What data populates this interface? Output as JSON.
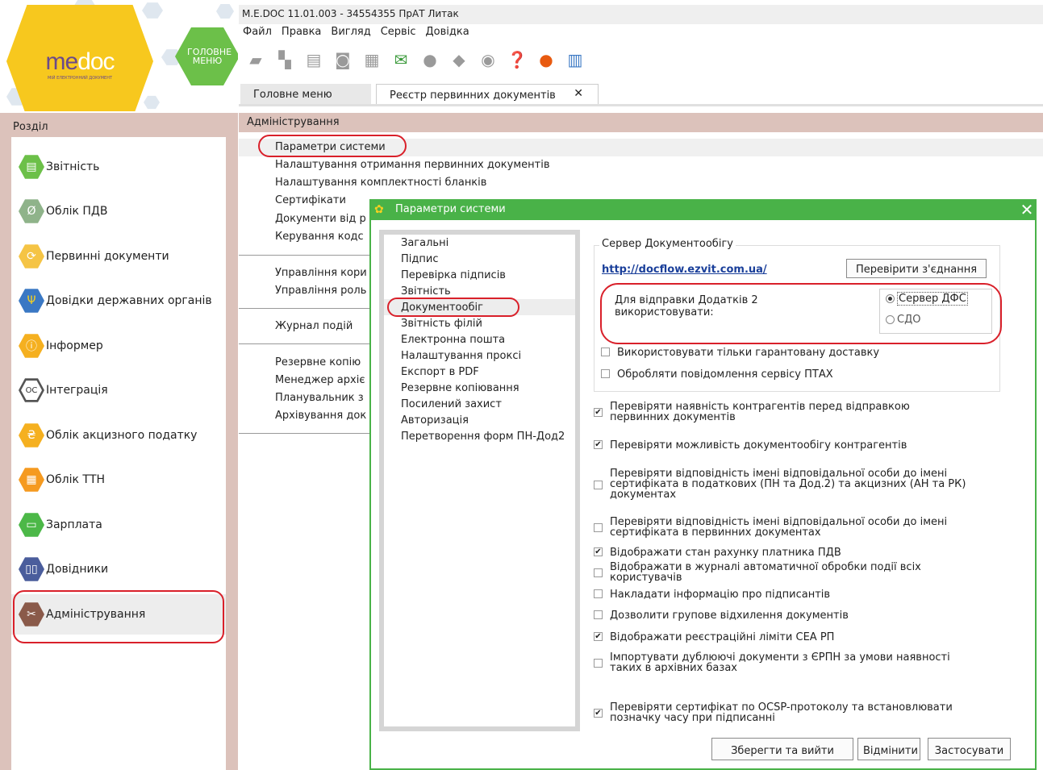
{
  "window": {
    "title": "M.E.DOC 11.01.003 - 34554355 ПрАТ Литак"
  },
  "brand": {
    "name_me": "me",
    "name_doc": "doc",
    "tagline": "МІЙ ЕЛЕКТРОННИЙ ДОКУМЕНТ",
    "main_menu_label": "ГОЛОВНЕ МЕНЮ"
  },
  "menu": [
    "Файл",
    "Правка",
    "Вигляд",
    "Сервіс",
    "Довідка"
  ],
  "tabs": {
    "main": "Головне меню",
    "registry": "Реєстр первинних документів",
    "close": "✕"
  },
  "sidebar": {
    "header": "Розділ",
    "items": [
      {
        "label": "Звітність",
        "icon": "report-icon",
        "color": "#6cc049"
      },
      {
        "label": "Облік ПДВ",
        "icon": "vat-icon",
        "color": "#8fb38a"
      },
      {
        "label": "Первинні документи",
        "icon": "primary-docs-icon",
        "color": "#f5c445"
      },
      {
        "label": "Довідки державних органів",
        "icon": "trident-icon",
        "color": "#3a78c4"
      },
      {
        "label": "Інформер",
        "icon": "info-icon",
        "color": "#f5b020"
      },
      {
        "label": "Інтеграція",
        "icon": "integration-icon",
        "color": "#ffffff"
      },
      {
        "label": "Облік акцизного податку",
        "icon": "excise-icon",
        "color": "#f5b020"
      },
      {
        "label": "Облік ТТН",
        "icon": "ttn-icon",
        "color": "#f59a20"
      },
      {
        "label": "Зарплата",
        "icon": "salary-icon",
        "color": "#4cb848"
      },
      {
        "label": "Довідники",
        "icon": "book-icon",
        "color": "#4a5d9c"
      },
      {
        "label": "Адміністрування",
        "icon": "admin-icon",
        "color": "#8a5a4a"
      }
    ]
  },
  "content": {
    "header": "Адміністрування",
    "links": [
      "Параметри системи",
      "Налаштування отримання первинних документів",
      "Налаштування комплектності бланків",
      "Сертифікати",
      "Документи від р",
      "Керування кодс",
      "Управління кори",
      "Управління роль",
      "Журнал подій",
      "Резервне копію",
      "Менеджер архіє",
      "Планувальник з",
      "Архівування док"
    ]
  },
  "dialog": {
    "title": "Параметри системи",
    "close": "✕",
    "nav": [
      "Загальні",
      "Підпис",
      "Перевірка підписів",
      "Звітність",
      "Документообіг",
      "Звітність філій",
      "Електронна пошта",
      "Налаштування проксі",
      "Експорт в PDF",
      "Резервне копіювання",
      "Посилений захист",
      "Авторизація",
      "Перетворення форм ПН-Дод2"
    ],
    "server_group_title": "Сервер Документообігу",
    "server_url": "http://docflow.ezvit.com.ua/",
    "check_button": "Перевірити з'єднання",
    "send_label": "Для відправки Додатків 2\nвикористовувати:",
    "radio_options": [
      {
        "label": "Сервер ДФС",
        "checked": true
      },
      {
        "label": "СДО",
        "checked": false
      }
    ],
    "group_checks": [
      {
        "label": "Використовувати тільки гарантовану доставку",
        "checked": false
      },
      {
        "label": "Обробляти повідомлення сервісу ПТАХ",
        "checked": false
      }
    ],
    "checks": [
      {
        "label": "Перевіряти наявність контрагентів перед відправкою\nпервинних документів",
        "checked": true
      },
      {
        "label": "Перевіряти можливість документообігу контрагентів",
        "checked": true
      },
      {
        "label": "Перевіряти відповідність імені відповідальної особи до імені\nсертифіката в податкових (ПН та Дод.2) та акцизних (АН та РК)\nдокументах",
        "checked": false
      },
      {
        "label": "Перевіряти відповідність імені відповідальної особи до імені\nсертифіката в первинних документах",
        "checked": false
      },
      {
        "label": "Відображати стан рахунку платника ПДВ",
        "checked": true
      },
      {
        "label": "Відображати в журналі автоматичної обробки події всіх\nкористувачів",
        "checked": false
      },
      {
        "label": "Накладати інформацію про підписантів",
        "checked": false
      },
      {
        "label": "Дозволити групове відхилення документів",
        "checked": false
      },
      {
        "label": "Відображати реєстраційні ліміти СЕА РП",
        "checked": true
      },
      {
        "label": "Імпортувати дублюючі документи з ЄРПН за умови наявності\nтаких в архівних базах",
        "checked": false
      },
      {
        "label": "Перевіряти сертифікат по OCSP-протоколу та встановлювати\nпозначку часу при підписанні",
        "checked": true
      }
    ],
    "buttons": {
      "save": "Зберегти та вийти",
      "cancel": "Відмінити",
      "apply": "Застосувати"
    }
  },
  "colors": {
    "accent_green": "#49b248",
    "section_bg": "#dcc2bb",
    "highlight_red": "#d9202a",
    "brand_yellow": "#f7c81e"
  }
}
